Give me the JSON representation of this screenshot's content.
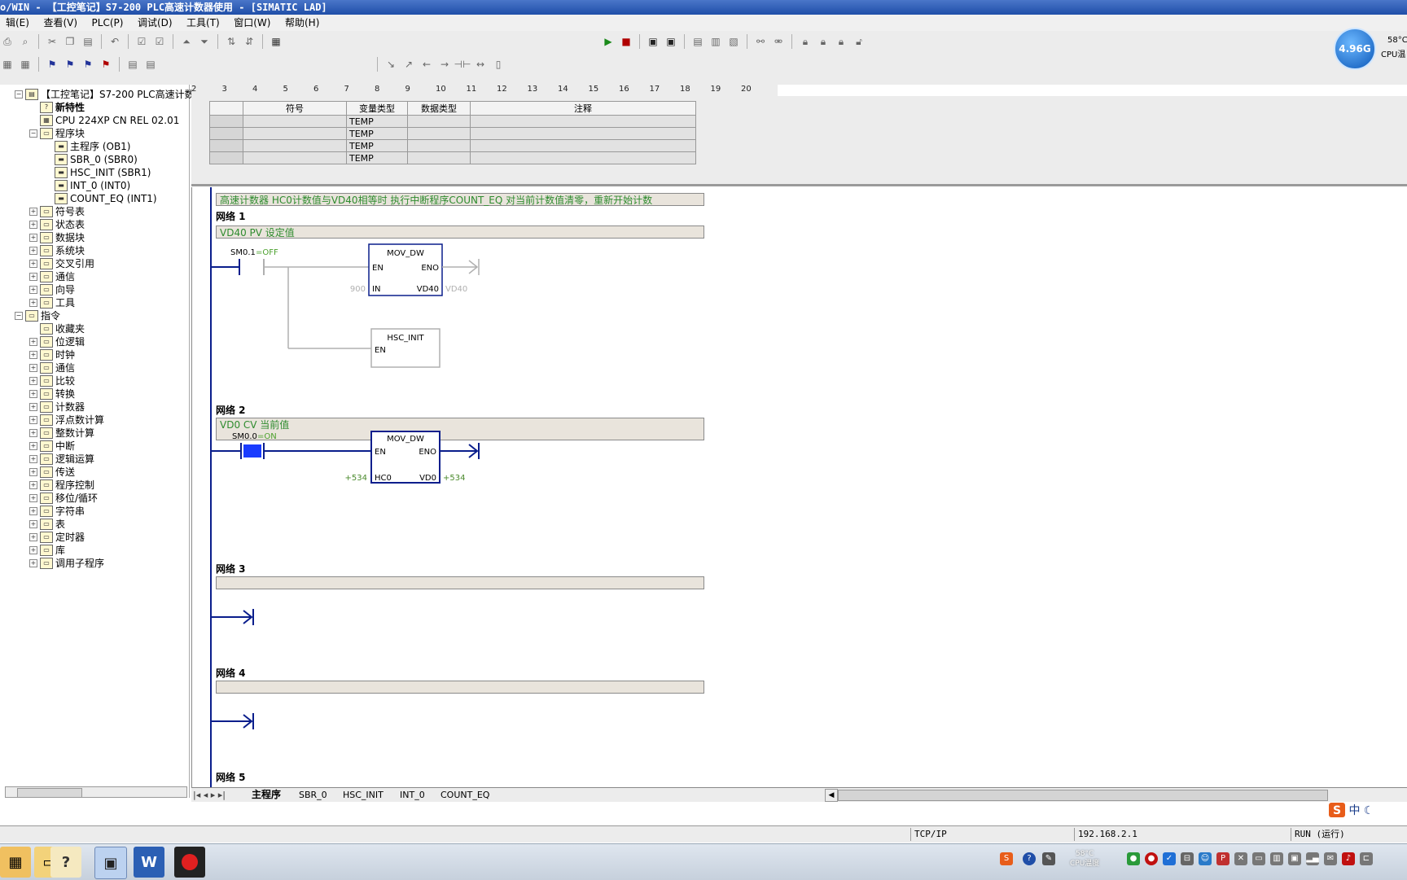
{
  "window": {
    "title": "o/WIN - 【工控笔记】S7-200 PLC高速计数器使用 - [SIMATIC LAD]"
  },
  "menu": [
    "辑(E)",
    "查看(V)",
    "PLC(P)",
    "调试(D)",
    "工具(T)",
    "窗口(W)",
    "帮助(H)"
  ],
  "widget": {
    "value": "4.96G",
    "temp": "58°C",
    "label": "CPU温"
  },
  "tree": [
    {
      "label": "【工控笔记】S7-200 PLC高速计数",
      "indent": 0,
      "pm": "⊟",
      "icon": "project-icon"
    },
    {
      "label": "新特性",
      "indent": 1,
      "pm": "",
      "icon": "help-icon",
      "bold": true
    },
    {
      "label": "CPU 224XP CN REL 02.01",
      "indent": 1,
      "pm": "",
      "icon": "cpu-icon"
    },
    {
      "label": "程序块",
      "indent": 1,
      "pm": "⊟",
      "icon": "folder-icon"
    },
    {
      "label": "主程序 (OB1)",
      "indent": 2,
      "pm": "",
      "icon": "block-icon"
    },
    {
      "label": "SBR_0 (SBR0)",
      "indent": 2,
      "pm": "",
      "icon": "block-icon"
    },
    {
      "label": "HSC_INIT (SBR1)",
      "indent": 2,
      "pm": "",
      "icon": "block-icon"
    },
    {
      "label": "INT_0 (INT0)",
      "indent": 2,
      "pm": "",
      "icon": "block-icon"
    },
    {
      "label": "COUNT_EQ (INT1)",
      "indent": 2,
      "pm": "",
      "icon": "block-icon"
    },
    {
      "label": "符号表",
      "indent": 1,
      "pm": "⊞",
      "icon": "folder-icon"
    },
    {
      "label": "状态表",
      "indent": 1,
      "pm": "⊞",
      "icon": "folder-icon"
    },
    {
      "label": "数据块",
      "indent": 1,
      "pm": "⊞",
      "icon": "folder-icon"
    },
    {
      "label": "系统块",
      "indent": 1,
      "pm": "⊞",
      "icon": "folder-icon"
    },
    {
      "label": "交叉引用",
      "indent": 1,
      "pm": "⊞",
      "icon": "folder-icon"
    },
    {
      "label": "通信",
      "indent": 1,
      "pm": "⊞",
      "icon": "folder-icon"
    },
    {
      "label": "向导",
      "indent": 1,
      "pm": "⊞",
      "icon": "folder-icon"
    },
    {
      "label": "工具",
      "indent": 1,
      "pm": "⊞",
      "icon": "folder-icon"
    },
    {
      "label": "指令",
      "indent": 0,
      "pm": "⊟",
      "icon": "folder-icon"
    },
    {
      "label": "收藏夹",
      "indent": 1,
      "pm": "",
      "icon": "folder-icon"
    },
    {
      "label": "位逻辑",
      "indent": 1,
      "pm": "⊞",
      "icon": "folder-icon"
    },
    {
      "label": "时钟",
      "indent": 1,
      "pm": "⊞",
      "icon": "folder-icon"
    },
    {
      "label": "通信",
      "indent": 1,
      "pm": "⊞",
      "icon": "folder-icon"
    },
    {
      "label": "比较",
      "indent": 1,
      "pm": "⊞",
      "icon": "folder-icon"
    },
    {
      "label": "转换",
      "indent": 1,
      "pm": "⊞",
      "icon": "folder-icon"
    },
    {
      "label": "计数器",
      "indent": 1,
      "pm": "⊞",
      "icon": "folder-icon"
    },
    {
      "label": "浮点数计算",
      "indent": 1,
      "pm": "⊞",
      "icon": "folder-icon"
    },
    {
      "label": "整数计算",
      "indent": 1,
      "pm": "⊞",
      "icon": "folder-icon"
    },
    {
      "label": "中断",
      "indent": 1,
      "pm": "⊞",
      "icon": "folder-icon"
    },
    {
      "label": "逻辑运算",
      "indent": 1,
      "pm": "⊞",
      "icon": "folder-icon"
    },
    {
      "label": "传送",
      "indent": 1,
      "pm": "⊞",
      "icon": "folder-icon"
    },
    {
      "label": "程序控制",
      "indent": 1,
      "pm": "⊞",
      "icon": "folder-icon"
    },
    {
      "label": "移位/循环",
      "indent": 1,
      "pm": "⊞",
      "icon": "folder-icon"
    },
    {
      "label": "字符串",
      "indent": 1,
      "pm": "⊞",
      "icon": "folder-icon"
    },
    {
      "label": "表",
      "indent": 1,
      "pm": "⊞",
      "icon": "folder-icon"
    },
    {
      "label": "定时器",
      "indent": 1,
      "pm": "⊞",
      "icon": "folder-icon"
    },
    {
      "label": "库",
      "indent": 1,
      "pm": "⊞",
      "icon": "folder-icon"
    },
    {
      "label": "调用子程序",
      "indent": 1,
      "pm": "⊞",
      "icon": "folder-icon"
    }
  ],
  "ruler": [
    "2",
    "3",
    "4",
    "5",
    "6",
    "7",
    "8",
    "9",
    "10",
    "11",
    "12",
    "13",
    "14",
    "15",
    "16",
    "17",
    "18",
    "19",
    "20"
  ],
  "var_table": {
    "headers": [
      "符号",
      "变量类型",
      "数据类型",
      "注释"
    ],
    "rows": [
      [
        "",
        "TEMP",
        "",
        ""
      ],
      [
        "",
        "TEMP",
        "",
        ""
      ],
      [
        "",
        "TEMP",
        "",
        ""
      ],
      [
        "",
        "TEMP",
        "",
        ""
      ]
    ]
  },
  "program": {
    "comment": "高速计数器 HC0计数值与VD40相等时 执行中断程序COUNT_EQ 对当前计数值清零，重新开始计数",
    "networks": [
      {
        "title": "网络 1",
        "comment": "VD40 PV 设定值",
        "contact": "SM0.1",
        "contact_state": "OFF",
        "box1": {
          "name": "MOV_DW",
          "en": "EN",
          "eno": "ENO",
          "in_pin": "IN",
          "in_val": "900",
          "out_pin": "VD40",
          "out_val": "VD40"
        },
        "box2": {
          "name": "HSC_INIT",
          "en": "EN"
        }
      },
      {
        "title": "网络 2",
        "comment": "VD0 CV 当前值",
        "contact": "SM0.0",
        "contact_state": "ON",
        "box1": {
          "name": "MOV_DW",
          "en": "EN",
          "eno": "ENO",
          "in_pin": "HC0",
          "in_val": "+534",
          "out_pin": "VD0",
          "out_val": "+534"
        }
      },
      {
        "title": "网络 3",
        "comment": ""
      },
      {
        "title": "网络 4",
        "comment": ""
      },
      {
        "title": "网络 5"
      }
    ]
  },
  "tabs": [
    "主程序",
    "SBR_0",
    "HSC_INIT",
    "INT_0",
    "COUNT_EQ"
  ],
  "status": {
    "protocol": "TCP/IP",
    "address": "192.168.2.1",
    "mode": "RUN (运行)"
  },
  "taskbar": {
    "temp": "58°C",
    "temp_label": "CPU温度"
  },
  "ime": {
    "label": "中"
  },
  "colors": {
    "titlebar": "#1f4ea8",
    "comment_text": "#2e8b2e",
    "active_rung": "#0a1e8c",
    "inactive_rung": "#b0b0b0",
    "on_state": "#4aa02c",
    "contact_on": "#1a3cff"
  }
}
